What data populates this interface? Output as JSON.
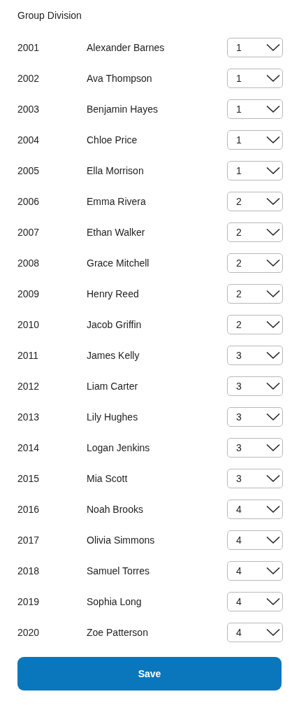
{
  "title": "Group Division",
  "rows": [
    {
      "id": "2001",
      "name": "Alexander Barnes",
      "group": "1"
    },
    {
      "id": "2002",
      "name": "Ava Thompson",
      "group": "1"
    },
    {
      "id": "2003",
      "name": "Benjamin Hayes",
      "group": "1"
    },
    {
      "id": "2004",
      "name": "Chloe Price",
      "group": "1"
    },
    {
      "id": "2005",
      "name": "Ella Morrison",
      "group": "1"
    },
    {
      "id": "2006",
      "name": "Emma Rivera",
      "group": "2"
    },
    {
      "id": "2007",
      "name": "Ethan Walker",
      "group": "2"
    },
    {
      "id": "2008",
      "name": "Grace Mitchell",
      "group": "2"
    },
    {
      "id": "2009",
      "name": "Henry Reed",
      "group": "2"
    },
    {
      "id": "2010",
      "name": "Jacob Griffin",
      "group": "2"
    },
    {
      "id": "2011",
      "name": "James Kelly",
      "group": "3"
    },
    {
      "id": "2012",
      "name": "Liam Carter",
      "group": "3"
    },
    {
      "id": "2013",
      "name": "Lily Hughes",
      "group": "3"
    },
    {
      "id": "2014",
      "name": "Logan Jenkins",
      "group": "3"
    },
    {
      "id": "2015",
      "name": "Mia Scott",
      "group": "3"
    },
    {
      "id": "2016",
      "name": "Noah Brooks",
      "group": "4"
    },
    {
      "id": "2017",
      "name": "Olivia Simmons",
      "group": "4"
    },
    {
      "id": "2018",
      "name": "Samuel Torres",
      "group": "4"
    },
    {
      "id": "2019",
      "name": "Sophia Long",
      "group": "4"
    },
    {
      "id": "2020",
      "name": "Zoe Patterson",
      "group": "4"
    }
  ],
  "save_button": "Save"
}
